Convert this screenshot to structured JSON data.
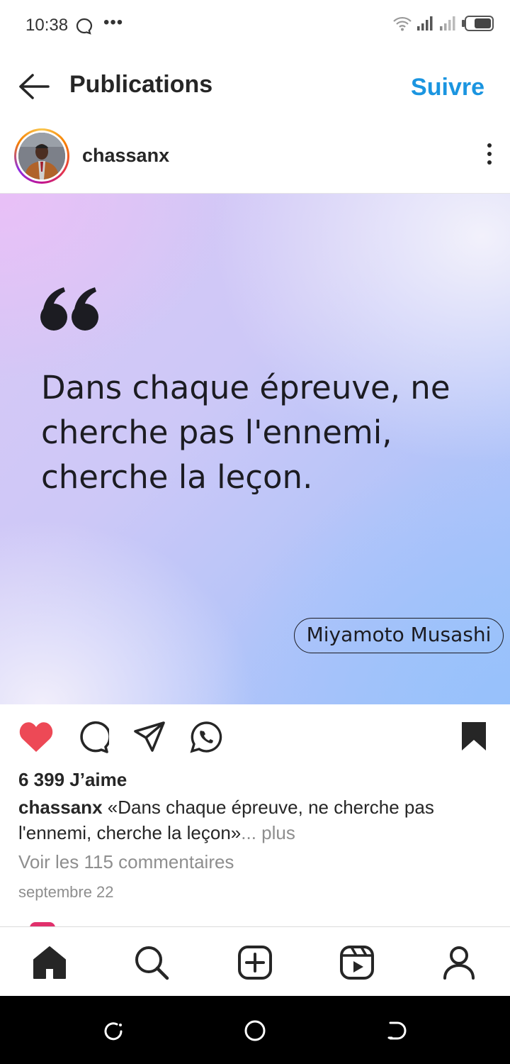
{
  "status_bar": {
    "time": "10:38",
    "dots": "•••"
  },
  "header": {
    "title": "Publications",
    "follow_label": "Suivre"
  },
  "post": {
    "username": "chassanx",
    "quote_text": "Dans chaque épreuve, ne cherche pas l'ennemi, cherche la leçon.",
    "quote_author": "Miyamoto Musashi",
    "liked": true,
    "saved": true,
    "likes": "6 399 J’aime",
    "caption_user": "chassanx",
    "caption_text": " «Dans chaque épreuve, ne cherche pas l'ennemi, cherche la leçon»",
    "caption_more": "... plus",
    "comments_link": "Voir les 115 commentaires",
    "date": "septembre 22"
  },
  "colors": {
    "accent": "#1b95e0",
    "like": "#ed4956",
    "text": "#262626",
    "muted": "#8e8e8e"
  },
  "bottom_nav": [
    "home-icon",
    "search-icon",
    "create-icon",
    "reels-icon",
    "profile-icon"
  ],
  "system_nav": [
    "recents-icon",
    "home-circle-icon",
    "back-icon"
  ]
}
